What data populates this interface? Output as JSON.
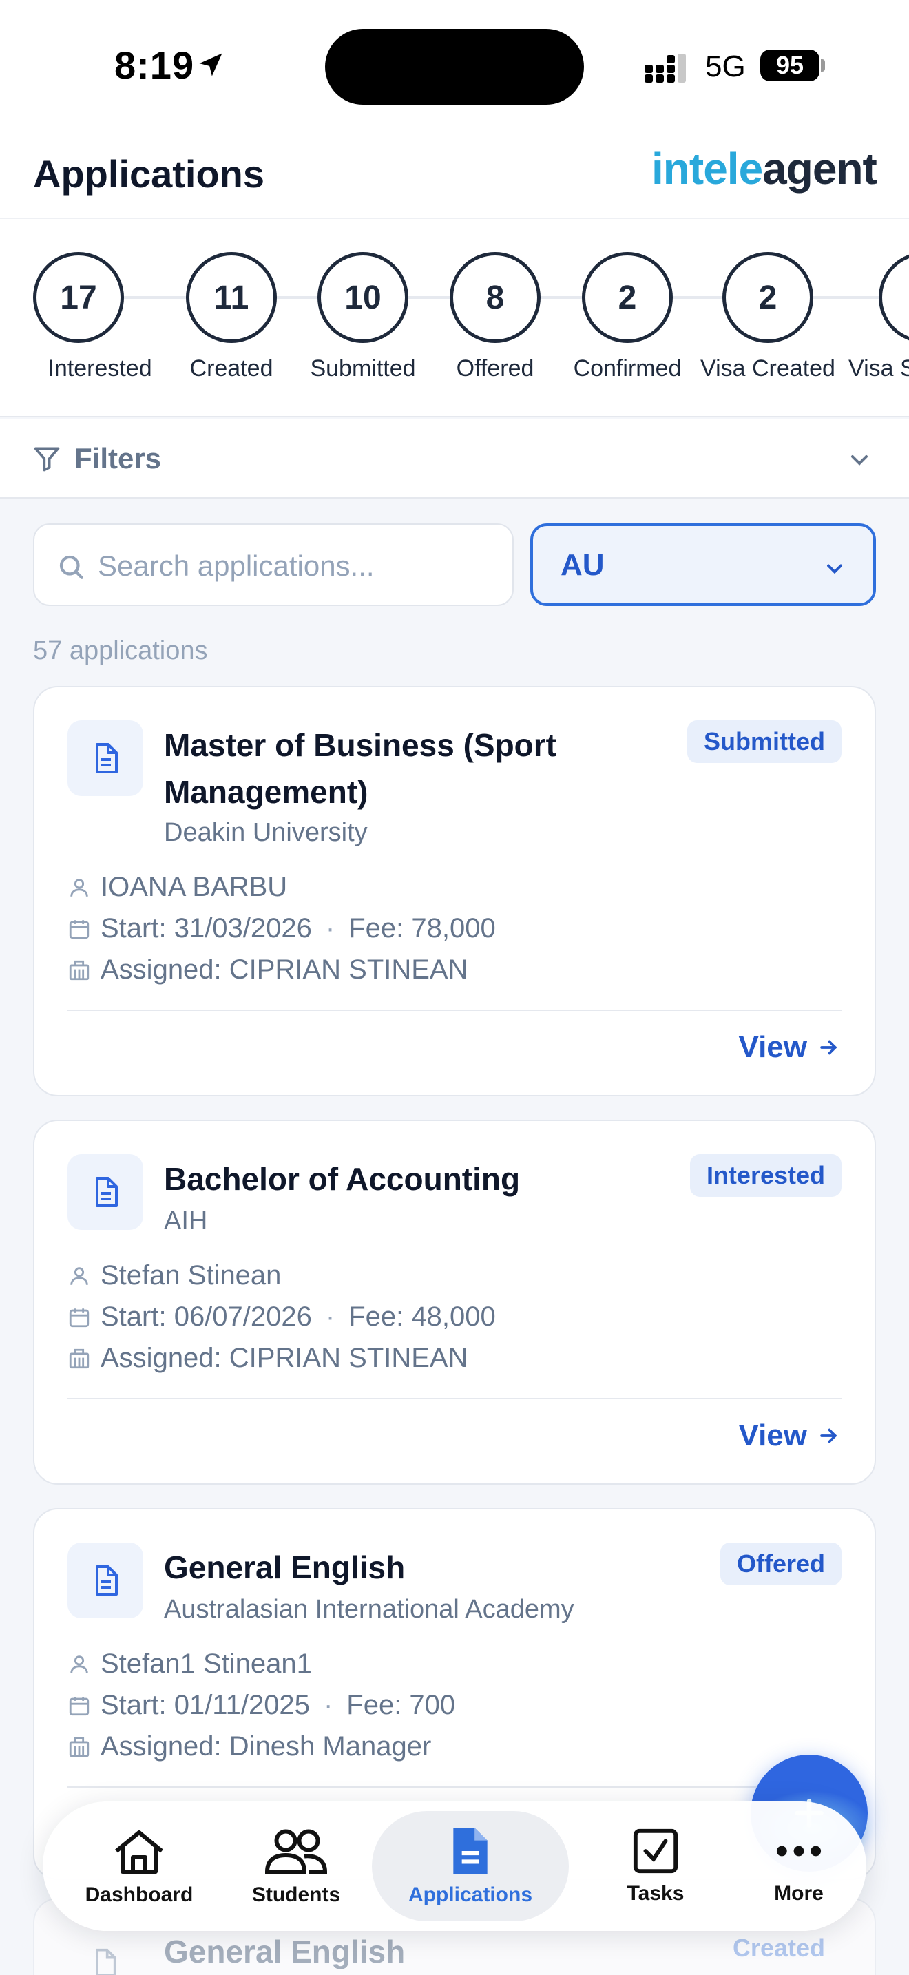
{
  "status_bar": {
    "time": "8:19",
    "network": "5G",
    "battery": "95"
  },
  "header": {
    "title": "Applications",
    "logo_part1": "intele",
    "logo_part2": "agent"
  },
  "stages": [
    {
      "count": "17",
      "label": "Interested"
    },
    {
      "count": "11",
      "label": "Created"
    },
    {
      "count": "10",
      "label": "Submitted"
    },
    {
      "count": "8",
      "label": "Offered"
    },
    {
      "count": "2",
      "label": "Confirmed"
    },
    {
      "count": "2",
      "label": "Visa Created"
    },
    {
      "count": "",
      "label": "Visa S"
    }
  ],
  "filters": {
    "label": "Filters"
  },
  "search": {
    "placeholder": "Search applications...",
    "value": ""
  },
  "country_filter": {
    "value": "AU"
  },
  "results": {
    "count_text": "57 applications"
  },
  "applications": [
    {
      "title": "Master of Business (Sport Management)",
      "institution": "Deakin University",
      "status": "Submitted",
      "student": "IOANA BARBU",
      "start": "Start: 31/03/2026",
      "fee": "Fee: 78,000",
      "assigned": "Assigned: CIPRIAN STINEAN",
      "view_label": "View"
    },
    {
      "title": "Bachelor of Accounting",
      "institution": "AIH",
      "status": "Interested",
      "student": "Stefan Stinean",
      "start": "Start: 06/07/2026",
      "fee": "Fee: 48,000",
      "assigned": "Assigned: CIPRIAN STINEAN",
      "view_label": "View"
    },
    {
      "title": "General English",
      "institution": "Australasian International Academy",
      "status": "Offered",
      "student": "Stefan1 Stinean1",
      "start": "Start: 01/11/2025",
      "fee": "Fee: 700",
      "assigned": "Assigned: Dinesh Manager",
      "view_label": "View"
    },
    {
      "title": "General English",
      "status": "Created"
    }
  ],
  "tabbar": {
    "items": [
      {
        "label": "Dashboard",
        "icon": "home-icon"
      },
      {
        "label": "Students",
        "icon": "users-icon"
      },
      {
        "label": "Applications",
        "icon": "document-icon",
        "active": true
      },
      {
        "label": "Tasks",
        "icon": "checkbox-icon"
      },
      {
        "label": "More",
        "icon": "more-icon"
      }
    ]
  },
  "colors": {
    "accent": "#2f6fdc",
    "dark": "#1e293b",
    "badge_bg": "#e8effb",
    "logo_blue": "#29a8db"
  }
}
